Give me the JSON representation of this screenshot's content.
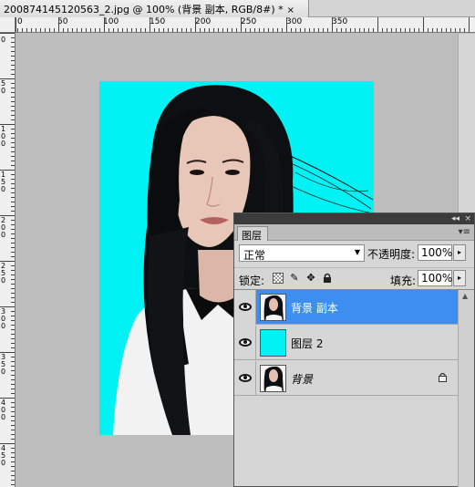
{
  "document": {
    "title": "200874145120563_2.jpg @ 100% (背景 副本, RGB/8#) *",
    "close_symbol": "×"
  },
  "ruler_h": {
    "labels": [
      "0",
      "50",
      "100",
      "150",
      "200",
      "250",
      "300",
      "350"
    ]
  },
  "ruler_v": {
    "labels": [
      "0",
      "5 0",
      "1 0 0",
      "1 5 0",
      "2 0 0",
      "2 5 0",
      "3 0 0",
      "3 5 0",
      "4 0 0",
      "4 5 0"
    ]
  },
  "layers_panel": {
    "tab_label": "图层",
    "collapse_symbol": "◂◂",
    "close_symbol": "×",
    "menu_icon": "▾≡",
    "blend_mode": "正常",
    "opacity_label": "不透明度:",
    "opacity_value": "100%",
    "lock_label": "锁定:",
    "fill_label": "填充:",
    "fill_value": "100%",
    "layers": [
      {
        "name": "背景 副本",
        "selected": true,
        "thumb": "photo"
      },
      {
        "name": "图层 2",
        "selected": false,
        "thumb": "cyan"
      },
      {
        "name": "背景",
        "selected": false,
        "thumb": "photo",
        "locked": true
      }
    ]
  },
  "colors": {
    "canvas_bg": "#00f2f4",
    "selection": "#3d8ef0",
    "workspace": "#bdbdbd"
  },
  "icons": {
    "lock_transparent": "checker-icon",
    "lock_pixels": "brush-icon",
    "lock_position": "move-icon",
    "lock_all": "lock-icon",
    "visibility": "eye-icon"
  }
}
